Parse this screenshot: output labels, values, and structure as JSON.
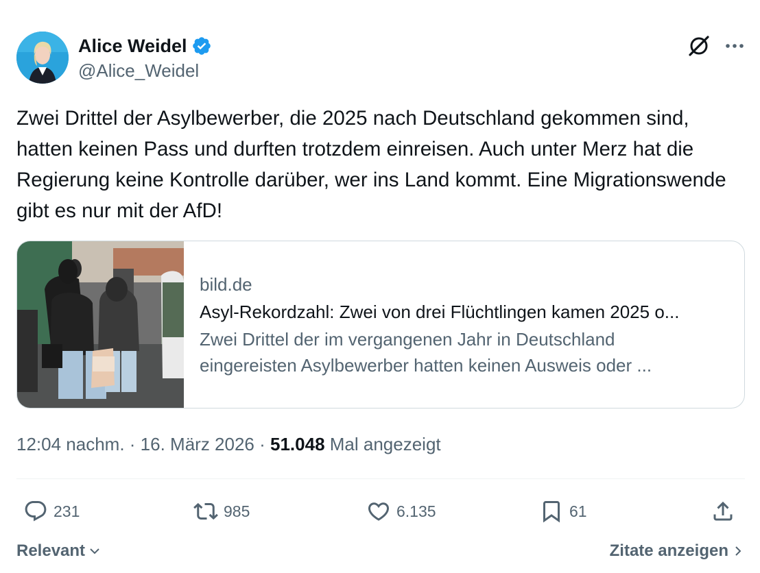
{
  "author": {
    "display_name": "Alice Weidel",
    "handle": "@Alice_Weidel",
    "verified_icon": "verified-badge-icon",
    "accent_color": "#1d9bf0"
  },
  "tweet": {
    "text": "Zwei Drittel der Asylbewerber, die 2025 nach Deutschland gekommen sind, hatten keinen Pass und durften trotzdem einreisen. Auch unter Merz hat die Regierung keine Kontrolle darüber, wer ins Land kommt. Eine Migrationswende gibt es nur mit der AfD!"
  },
  "card": {
    "domain": "bild.de",
    "title": "Asyl-Rekordzahl: Zwei von drei Flüchtlingen kamen 2025 o...",
    "description_line1": "Zwei Drittel der im vergangenen Jahr in Deutschland",
    "description_line2": "eingereisten Asylbewerber hatten keinen Ausweis oder ..."
  },
  "meta": {
    "time": "12:04 nachm.",
    "separator": " · ",
    "date": "16. März 2026",
    "views": "51.048",
    "views_label": "Mal angezeigt"
  },
  "actions": {
    "replies": "231",
    "reposts": "985",
    "likes": "6.135",
    "bookmarks": "61"
  },
  "footer": {
    "sort_label": "Relevant",
    "quotes_label": "Zitate anzeigen"
  }
}
